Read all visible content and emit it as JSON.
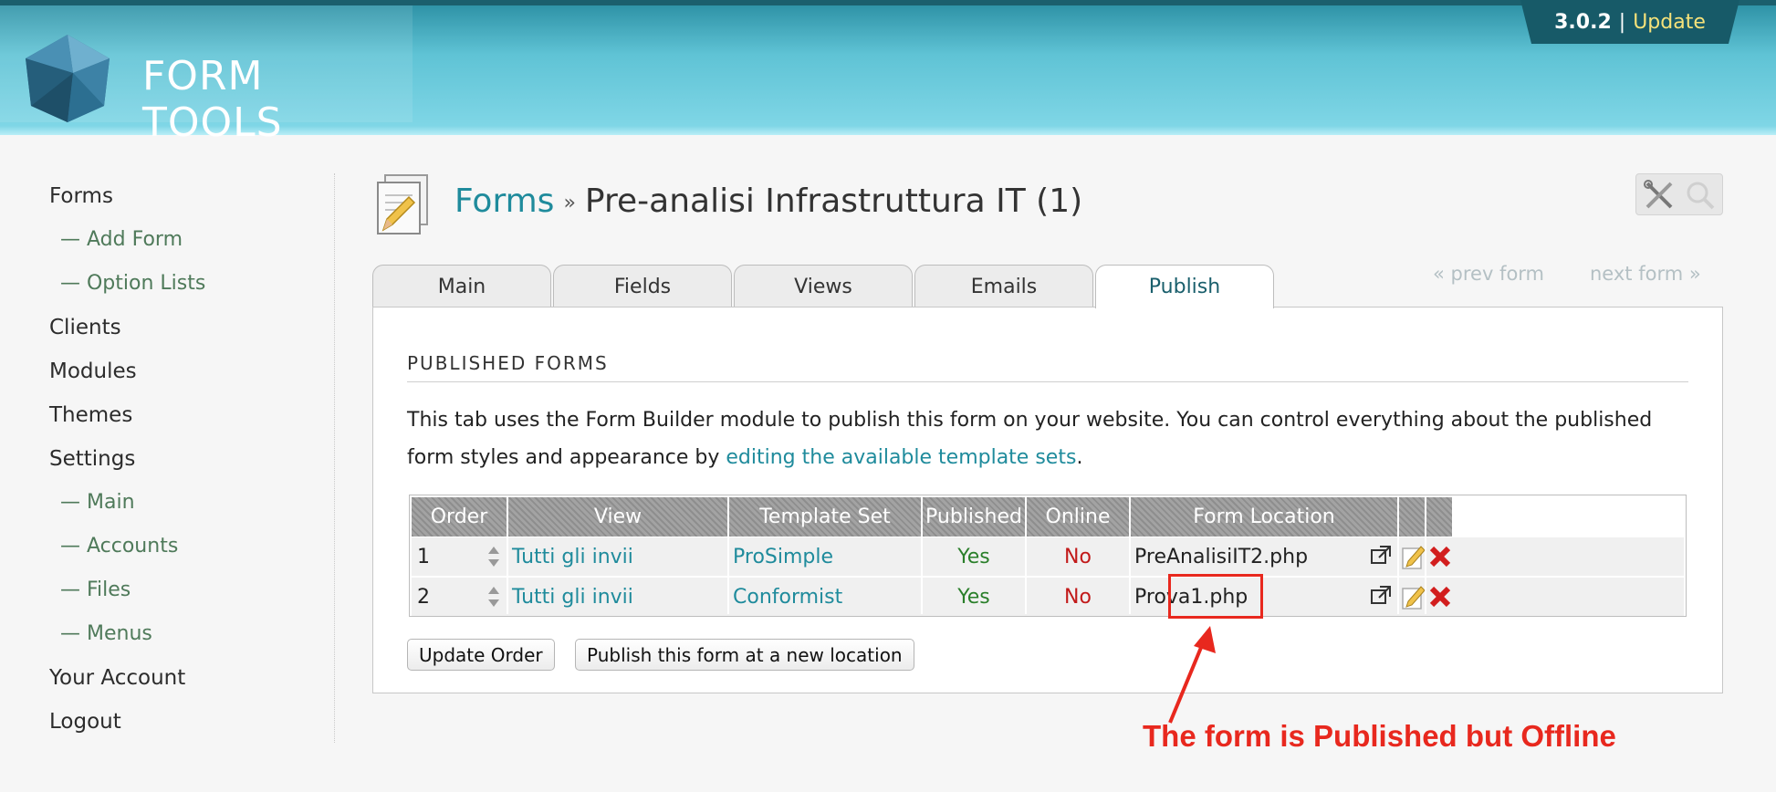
{
  "header": {
    "logo_text": "FORM TOOLS",
    "version": "3.0.2",
    "separator": "|",
    "update_label": "Update"
  },
  "sidebar": {
    "items": [
      {
        "label": "Forms",
        "level": 0
      },
      {
        "label": "— Add Form",
        "level": 1
      },
      {
        "label": "— Option Lists",
        "level": 1
      },
      {
        "label": "Clients",
        "level": 0
      },
      {
        "label": "Modules",
        "level": 0
      },
      {
        "label": "Themes",
        "level": 0
      },
      {
        "label": "Settings",
        "level": 0
      },
      {
        "label": "— Main",
        "level": 1
      },
      {
        "label": "— Accounts",
        "level": 1
      },
      {
        "label": "— Files",
        "level": 1
      },
      {
        "label": "— Menus",
        "level": 1
      },
      {
        "label": "Your Account",
        "level": 0
      },
      {
        "label": "Logout",
        "level": 0
      }
    ]
  },
  "page": {
    "breadcrumb": "Forms",
    "separator": "»",
    "title": "Pre-analisi Infrastruttura IT (1)"
  },
  "tabs": [
    {
      "label": "Main",
      "active": false
    },
    {
      "label": "Fields",
      "active": false
    },
    {
      "label": "Views",
      "active": false
    },
    {
      "label": "Emails",
      "active": false
    },
    {
      "label": "Publish",
      "active": true
    }
  ],
  "nav": {
    "prev": "« prev form",
    "next": "next form »"
  },
  "section": {
    "title": "PUBLISHED FORMS",
    "desc_before": "This tab uses the Form Builder module to publish this form on your website. You can control everything about the published form styles and appearance by ",
    "desc_link": "editing the available template sets",
    "desc_after": "."
  },
  "table": {
    "headers": [
      "Order",
      "View",
      "Template Set",
      "Published",
      "Online",
      "Form Location",
      "",
      ""
    ],
    "rows": [
      {
        "order": "1",
        "view": "Tutti gli invii",
        "template_set": "ProSimple",
        "published": "Yes",
        "online": "No",
        "location": "PreAnalisiIT2.php"
      },
      {
        "order": "2",
        "view": "Tutti gli invii",
        "template_set": "Conformist",
        "published": "Yes",
        "online": "No",
        "location": "Prova1.php"
      }
    ]
  },
  "buttons": {
    "update_order": "Update Order",
    "publish_new": "Publish this form at a new location"
  },
  "annotation": {
    "text": "The form is Published but Offline",
    "color": "#e8281e"
  },
  "colors": {
    "accent": "#1f8b9c",
    "header": "#5fc3d5",
    "yes": "#2a7f2a",
    "no": "#c21a1a"
  }
}
